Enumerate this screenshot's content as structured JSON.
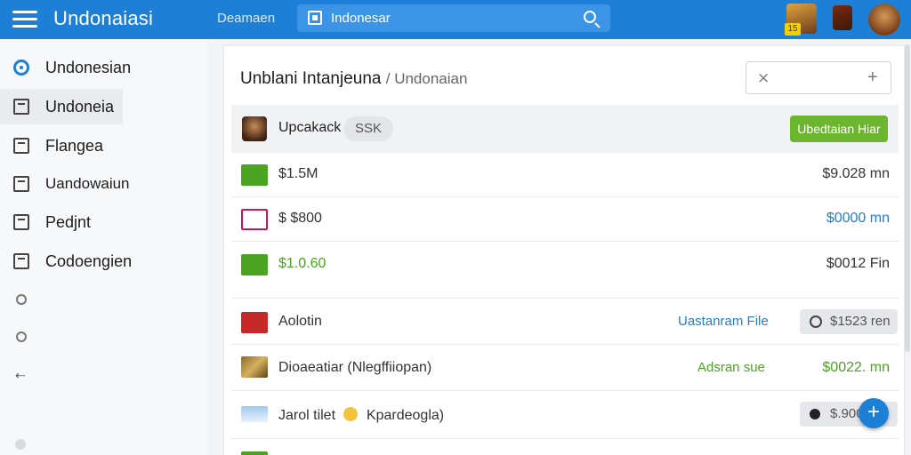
{
  "header": {
    "app_title": "Undonaiasi",
    "link": "Deamaen",
    "search_value": "Indonesar",
    "notification_count": "15"
  },
  "sidebar": {
    "items": [
      {
        "label": "Undonesian",
        "icon": "radio-icon"
      },
      {
        "label": "Undoneia",
        "icon": "shield-icon"
      },
      {
        "label": "Flangea",
        "icon": "document-icon"
      },
      {
        "label": "Uandowaiun",
        "icon": "mail-icon"
      },
      {
        "label": "Pedjnt",
        "icon": "edit-icon"
      },
      {
        "label": "Codoengien",
        "icon": "list-icon"
      }
    ]
  },
  "panel": {
    "title": "Unblani Intanjeuna",
    "subtitle": "/ Undonaian",
    "filter_x": "⨯",
    "filter_plus": "+"
  },
  "header_row": {
    "name": "Upcakack",
    "tag": "SSK",
    "button": "Ubedtaian Hiar"
  },
  "rows": [
    {
      "label": "$1.5M",
      "value": "$9.028 mn",
      "label_color": "#333",
      "value_color": "#333"
    },
    {
      "label": "$ $800",
      "value": "$0000 mn",
      "label_color": "#333",
      "value_color": "#1e7fd6"
    },
    {
      "label": "$1.0.60",
      "value": "$0012 Fin",
      "label_color": "#4aa321",
      "value_color": "#333"
    },
    {
      "label": "Aolotin",
      "status": "Uastanram File",
      "status_color": "#1e7fd6",
      "pill": "$1523 ren"
    },
    {
      "label": "Dioaeatiar (Nlegffiiopan)",
      "status": "Adsran sue",
      "status_color": "#4aa321",
      "value": "$0022. mn",
      "value_color": "#4aa321"
    },
    {
      "label": "Jarol tilet",
      "label2": "Kpardeogla)",
      "pill": "$.900"
    }
  ],
  "colors": {
    "accent": "#1e7fd6",
    "green": "#6bb52f"
  }
}
